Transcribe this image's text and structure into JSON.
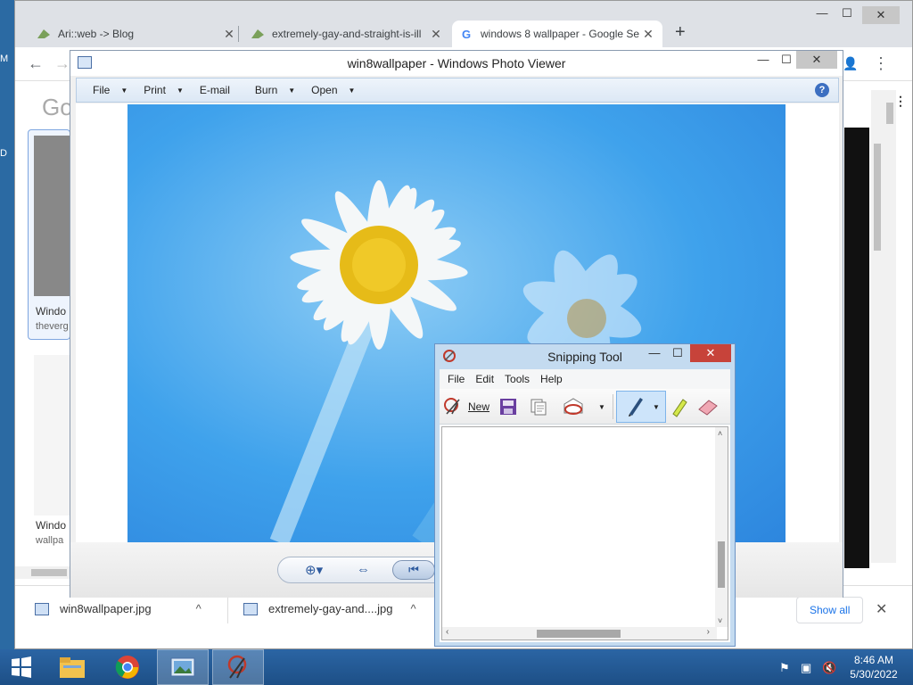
{
  "desktop": {
    "edge_text_1": "M",
    "edge_text_2": "D"
  },
  "chrome": {
    "tabs": [
      {
        "title": "Ari::web -> Blog",
        "close": "✕"
      },
      {
        "title": "extremely-gay-and-straight-is-ill",
        "close": "✕"
      },
      {
        "title": "windows 8 wallpaper - Google Se",
        "close": "✕"
      }
    ],
    "new_tab": "+",
    "window_controls": {
      "minimize": "—",
      "maximize": "☐",
      "close": "✕"
    },
    "toolbar": {
      "back": "←",
      "forward": "→",
      "profile": "👤",
      "menu": "⋮"
    },
    "page": {
      "logo": "Go",
      "apps_icon": "⋮⋮⋮",
      "cards": [
        {
          "title": "Windo",
          "source": "theverg"
        },
        {
          "title": "Windo",
          "source": "wallpa"
        }
      ]
    },
    "downloads": {
      "items": [
        {
          "name": "win8wallpaper.jpg",
          "chevron": "^"
        },
        {
          "name": "extremely-gay-and....jpg",
          "chevron": "^"
        }
      ],
      "show_all": "Show all",
      "close": "✕"
    }
  },
  "photo_viewer": {
    "title": "win8wallpaper - Windows Photo Viewer",
    "window_controls": {
      "minimize": "—",
      "maximize": "☐",
      "close": "✕"
    },
    "menu": [
      {
        "label": "File",
        "dropdown": true
      },
      {
        "label": "Print",
        "dropdown": true
      },
      {
        "label": "E-mail",
        "dropdown": false
      },
      {
        "label": "Burn",
        "dropdown": true
      },
      {
        "label": "Open",
        "dropdown": true
      }
    ],
    "help": "?",
    "nav": {
      "zoom": "⊕▾",
      "actual_size": "⇔",
      "previous": "⏮"
    }
  },
  "snipping_tool": {
    "title": "Snipping Tool",
    "window_controls": {
      "minimize": "—",
      "maximize": "☐",
      "close": "✕"
    },
    "menu": [
      "File",
      "Edit",
      "Tools",
      "Help"
    ],
    "new_label": "New"
  },
  "taskbar": {
    "time": "8:46 AM",
    "date": "5/30/2022"
  },
  "colors": {
    "taskbar": "#1d4f86",
    "snip_close": "#c7433a",
    "sky": "#3fa2ec",
    "show_all": "#1a73e8"
  }
}
